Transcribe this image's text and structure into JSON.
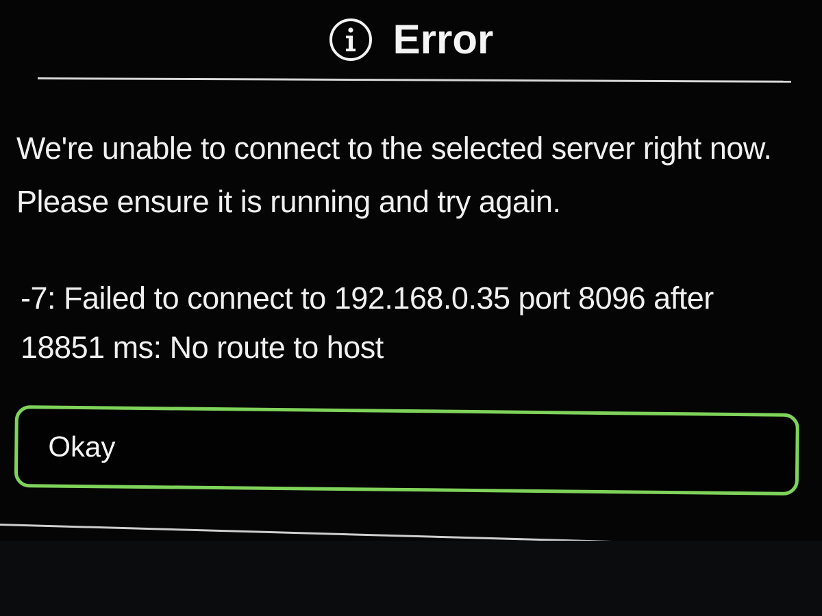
{
  "dialog": {
    "title": "Error",
    "icon": "info-circle-icon",
    "message_line1": "We're unable to connect to the selected server right now.",
    "message_line2": "Please ensure it is running and try again.",
    "error_line1": "-7: Failed to connect to 192.168.0.35 port 8096 after",
    "error_line2": "18851 ms: No route to host",
    "ok_label": "Okay"
  },
  "colors": {
    "background": "#000000",
    "text": "#f0f0f0",
    "focus_border": "#7fd35a",
    "divider": "#d8d8d8"
  }
}
